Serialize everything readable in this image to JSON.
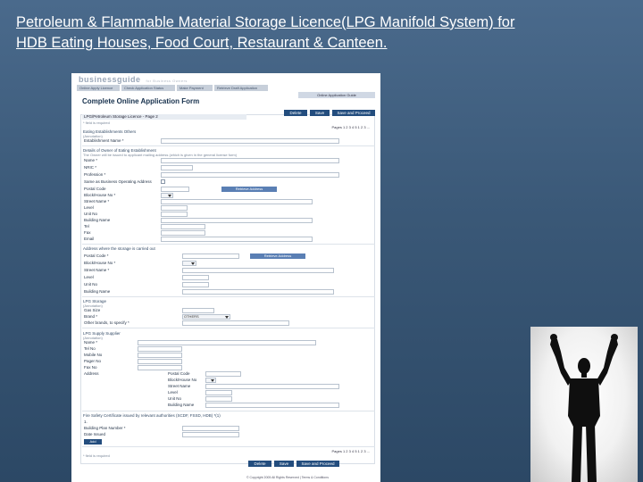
{
  "slide": {
    "title_line1": "Petroleum & Flammable Material Storage Licence(LPG Manifold System) for",
    "title_line2": "HDB Eating Houses, Food Court, Restaurant & Canteen."
  },
  "app": {
    "brand": "business",
    "brand_suffix": "guide",
    "brand_tag": "for Business Owners",
    "top_nav": [
      "Online Apply Licence",
      "Check Application Status",
      "Make Payment",
      "Retrieve Draft Application"
    ],
    "guide_link": "Online Application Guide",
    "page_heading": "Complete Online Application Form",
    "toolbar": [
      "Delete",
      "Save",
      "Save and Proceed"
    ],
    "form_header": "LPG/Petroleum Storage Licence - Page 2",
    "required_note": "* field is required",
    "pages_label": "Pages 1 2 3 4 5 1 2 3 ..."
  },
  "section1": {
    "title": "Eating Establishments Others",
    "sub": "(Annotation)",
    "fields": [
      "Establishment Name *"
    ]
  },
  "section2": {
    "title": "Details of Owner of Eating Establishment",
    "sub": "The Owner will be issued to applicant mailing address (which is given in the general license form)",
    "fields": [
      "Name *",
      "NRIC *",
      "Profession *",
      "Same as Business Operating Address",
      "Postal Code",
      "Block/House No *",
      "Street Name *",
      "Level",
      "Unit No",
      "Building Name",
      "Tel",
      "Fax",
      "Email"
    ],
    "retrieve_label": "Retrieve Address"
  },
  "section3": {
    "title": "Address where the storage is carried out",
    "fields": [
      "Postal Code *",
      "Block/House No *",
      "Street Name *",
      "Level",
      "Unit No",
      "Building Name"
    ],
    "retrieve_label": "Retrieve Address"
  },
  "section4": {
    "title": "LPG Storage",
    "sub": "(Annotation)",
    "fields": [
      "Gas Size",
      "Brand *",
      "Other brands, to specify *"
    ],
    "brand_selected": "OTHERS"
  },
  "section5": {
    "title": "LPG Supply Supplier",
    "sub": "(Annotation)",
    "fields": [
      "Name *",
      "Tel No",
      "Mobile No",
      "Pager No",
      "Fax No",
      "Address"
    ],
    "address_fields": [
      "Postal Code",
      "Block/House No",
      "Street Name",
      "Level",
      "Unit No",
      "Building Name"
    ]
  },
  "section6": {
    "title": "Fire Safety Certificate issued by relevant authorities (SCDF, FSSD, HDB) *(1)",
    "item_number": "1.",
    "fields": [
      "Building Plan Number *",
      "Date Issued"
    ],
    "add_label": "Add"
  },
  "footer": {
    "nav": [
      "Delete",
      "Save",
      "Save and Proceed"
    ],
    "copyright": "© Copyright 2005 All Rights Reserved | Terms & Conditions"
  }
}
